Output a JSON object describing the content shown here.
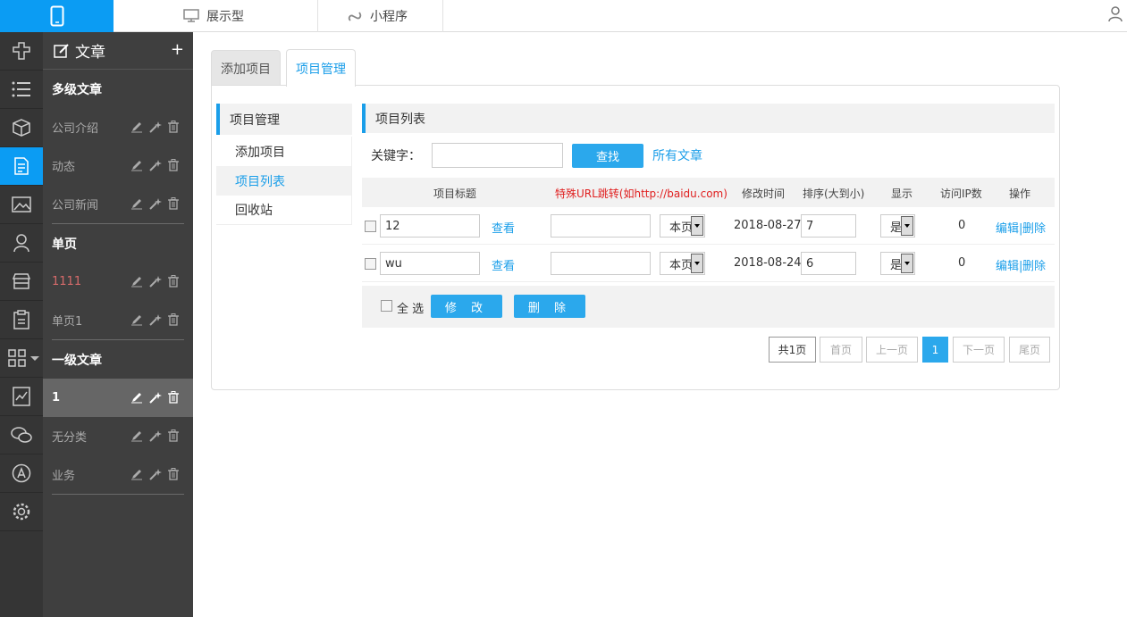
{
  "topbar": {
    "tabs": [
      {
        "label": "展示型",
        "icon": "monitor-icon"
      },
      {
        "label": "小程序",
        "icon": "mini-program-icon"
      }
    ]
  },
  "categories": {
    "title": "文章",
    "add_label": "+",
    "sections": [
      {
        "title": "多级文章",
        "items": [
          "公司介绍",
          "动态",
          "公司新闻"
        ]
      },
      {
        "title": "单页",
        "items": [
          "1111",
          "单页1"
        ]
      },
      {
        "title": "一级文章",
        "items": [
          "1",
          "无分类",
          "业务"
        ]
      }
    ]
  },
  "tabs": [
    "添加项目",
    "项目管理"
  ],
  "submenu": {
    "title": "项目管理",
    "items": [
      "添加项目",
      "项目列表",
      "回收站"
    ]
  },
  "list": {
    "title": "项目列表",
    "search_label": "关键字：",
    "search_value": "",
    "search_button": "查找",
    "all_link": "所有文章",
    "columns": [
      "项目标题",
      "特殊URL跳转(如http://baidu.com)",
      "修改时间",
      "排序(大到小)",
      "显示",
      "访问IP数",
      "操作"
    ],
    "rows": [
      {
        "title": "12",
        "view": "查看",
        "url": "",
        "target": "本页",
        "date": "2018-08-27",
        "order": "7",
        "show": "是",
        "ip": "0",
        "edit": "编辑|",
        "delete": "删除"
      },
      {
        "title": "wu",
        "view": "查看",
        "url": "",
        "target": "本页",
        "date": "2018-08-24",
        "order": "6",
        "show": "是",
        "ip": "0",
        "edit": "编辑|",
        "delete": "删除"
      }
    ],
    "select_all": "全 选",
    "modify_button": "修 改",
    "delete_button": "删 除"
  },
  "pager": {
    "total": "共1页",
    "first": "首页",
    "prev": "上一页",
    "current": "1",
    "next": "下一页",
    "last": "尾页"
  },
  "colors": {
    "accent": "#0b9cf3",
    "button": "#2ba8ec",
    "rail": "#353535",
    "sidebar": "#3f3f3f"
  }
}
